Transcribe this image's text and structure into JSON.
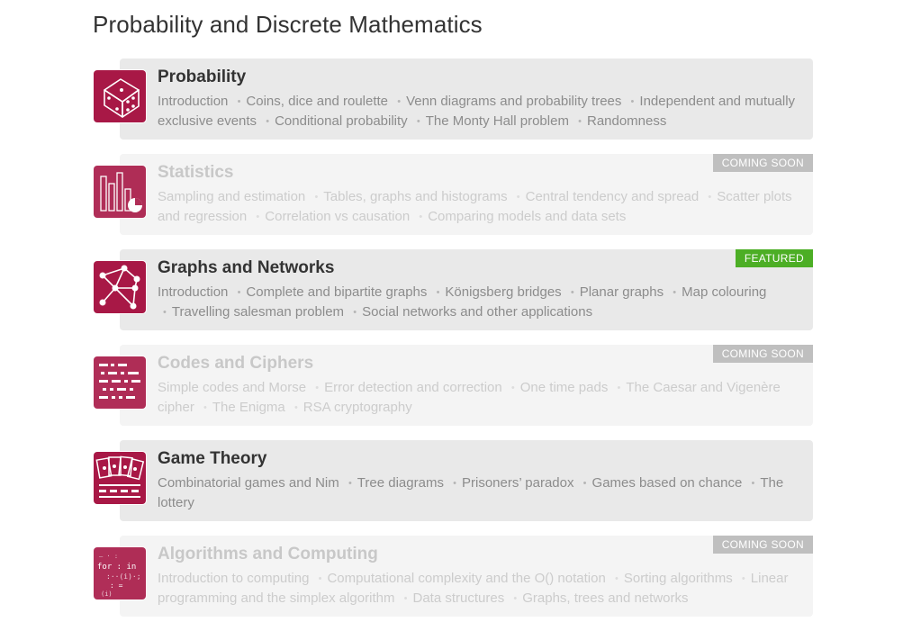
{
  "page": {
    "title": "Probability and Discrete Mathematics"
  },
  "courses": [
    {
      "title": "Probability",
      "badge": "",
      "topics": [
        "Introduction",
        "Coins, dice and roulette",
        "Venn diagrams and probability trees",
        "Independent and mutually exclusive events",
        "Conditional probability",
        "The Monty Hall problem",
        "Randomness"
      ],
      "icon": "dice-icon"
    },
    {
      "title": "Statistics",
      "badge": "COMING SOON",
      "topics": [
        "Sampling and estimation",
        "Tables, graphs and histograms",
        "Central tendency and spread",
        "Scatter plots and regression",
        "Correlation vs causation",
        "Comparing models and data sets"
      ],
      "icon": "bar-chart-icon"
    },
    {
      "title": "Graphs and Networks",
      "badge": "FEATURED",
      "topics": [
        "Introduction",
        "Complete and bipartite graphs",
        "Königsberg bridges",
        "Planar graphs",
        "Map colouring",
        "Travelling salesman problem",
        "Social networks and other applications"
      ],
      "icon": "network-graph-icon"
    },
    {
      "title": "Codes and Ciphers",
      "badge": "COMING SOON",
      "topics": [
        "Simple codes and Morse",
        "Error detection and correction",
        "One time pads",
        "The Caesar and Vigenère cipher",
        "The Enigma",
        "RSA cryptography"
      ],
      "icon": "morse-code-icon"
    },
    {
      "title": "Game Theory",
      "badge": "",
      "topics": [
        "Combinatorial games and Nim",
        "Tree diagrams",
        "Prisoners’ paradox",
        "Games based on chance",
        "The lottery"
      ],
      "icon": "playing-cards-icon"
    },
    {
      "title": "Algorithms and Computing",
      "badge": "COMING SOON",
      "topics": [
        "Introduction to computing",
        "Computational complexity and the O() notation",
        "Sorting algorithms",
        "Linear programming and the simplex algorithm",
        "Data structures",
        "Graphs, trees and networks"
      ],
      "icon": "code-icon",
      "icon_text": [
        "for : in",
        ": =",
        "(i)"
      ]
    }
  ],
  "colors": {
    "icon_bg": "#a81846",
    "featured": "#4cae25",
    "soon": "#bfbfbf"
  }
}
